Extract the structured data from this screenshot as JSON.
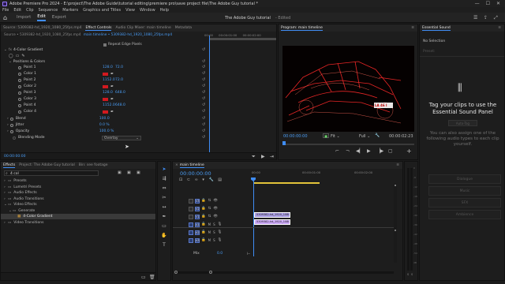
{
  "window": {
    "title": "Adobe Premiere Pro 2024 - E:\\project\\The Adobe Guide\\tutorial editing\\premiere pro\\save project file\\The Adobe Guy tutorial *",
    "minimize": "—",
    "maximize": "☐",
    "close": "✕"
  },
  "menu": [
    "File",
    "Edit",
    "Clip",
    "Sequence",
    "Markers",
    "Graphics and Titles",
    "View",
    "Window",
    "Help"
  ],
  "workspace": {
    "tabs": [
      "Import",
      "Edit",
      "Export"
    ],
    "active": "Edit",
    "project_title": "The Adobe Guy tutorial",
    "status": "- Edited"
  },
  "effect_controls": {
    "tabs": [
      "Source: 5309382-hd_1920_1080_25fps.mp4",
      "Effect Controls",
      "Audio Clip Mixer: main timeline",
      "Metadata"
    ],
    "source_line": "Source • 5309382-hd_1920_1080_25fps.mp4",
    "sequence_line": "main timeline • 5309382-hd_1920_1080_25fps.mp4",
    "mini_timecodes": [
      "00:00",
      "00:00:01:00",
      "00:00:02:00"
    ],
    "repeat_edge": "Repeat Edge Pixels",
    "effect_name": "4-Color Gradient",
    "section": "Positions & Colors",
    "rows": [
      {
        "label": "Point 1",
        "kind": "point",
        "x": "128.0",
        "y": "72.0"
      },
      {
        "label": "Color 1",
        "kind": "color"
      },
      {
        "label": "Point 2",
        "kind": "point",
        "x": "1152.0",
        "y": "72.0"
      },
      {
        "label": "Color 2",
        "kind": "color"
      },
      {
        "label": "Point 3",
        "kind": "point",
        "x": "128.0",
        "y": "648.0"
      },
      {
        "label": "Color 3",
        "kind": "color"
      },
      {
        "label": "Point 4",
        "kind": "point",
        "x": "1152.0",
        "y": "648.0"
      },
      {
        "label": "Color 4",
        "kind": "color"
      }
    ],
    "params": [
      {
        "label": "Blend",
        "value": "100.0"
      },
      {
        "label": "Jitter",
        "value": "0.0 %"
      },
      {
        "label": "Opacity",
        "value": "100.0 %"
      }
    ],
    "blend_mode_label": "Blending Mode",
    "blend_mode_value": "Overlay",
    "timecode": "00:00:00:00"
  },
  "program": {
    "title": "Program: main timeline",
    "timecode": "00:00:00:00",
    "fit": "Fit",
    "quality": "Full",
    "duration": "00:00:02:23",
    "plate": "LA 46 I"
  },
  "essential_sound": {
    "tab": "Essential Sound",
    "no_selection": "No Selection",
    "preset_label": "Preset:",
    "heading": "Tag your clips to use the Essential Sound Panel",
    "auto_tag": "Auto-Tag",
    "hint": "You can also assign one of the following audio types to each clip yourself.",
    "types": [
      "Dialogue",
      "Music",
      "SFX",
      "Ambience"
    ]
  },
  "project": {
    "tabs": [
      "Effects",
      "Project: The Adobe Guy tutorial",
      "Bin: see footage"
    ],
    "search": "4 col",
    "tree": [
      {
        "label": "Presets",
        "level": 0
      },
      {
        "label": "Lumetri Presets",
        "level": 0
      },
      {
        "label": "Audio Effects",
        "level": 0
      },
      {
        "label": "Audio Transitions",
        "level": 0
      },
      {
        "label": "Video Effects",
        "level": 0,
        "open": true
      },
      {
        "label": "Generate",
        "level": 1,
        "open": true
      },
      {
        "label": "4-Color Gradient",
        "level": 2,
        "selected": true
      },
      {
        "label": "Video Transitions",
        "level": 0
      }
    ]
  },
  "timeline": {
    "tab": "main timeline",
    "timecode": "00:00:00:00",
    "ruler": [
      "00:00",
      "00:00:01:00",
      "00:00:02:00"
    ],
    "video_tracks": [
      "V3",
      "V2",
      "V1"
    ],
    "audio_tracks": [
      "A1",
      "A2",
      "A3"
    ],
    "mix_label": "Mix",
    "mix_value": "0.0",
    "clips": [
      {
        "name": "5309382-hd_1920_1080_25fps.mp4",
        "track": "V2"
      },
      {
        "name": "5309382-hd_1920_1080_25fps.mp4",
        "track": "V1"
      }
    ],
    "meter_db": [
      "0",
      "-6",
      "-12",
      "-18",
      "-24",
      "-30",
      "-36",
      "-42",
      "-48",
      "-54",
      "dB"
    ]
  },
  "colors": {
    "accent": "#3f8df5",
    "timecode": "#4a9df5",
    "swatch": "#d1191f",
    "clip_v2": "#a79be0",
    "clip_v1": "#c9a6f5",
    "workarea": "#e2c33a"
  }
}
